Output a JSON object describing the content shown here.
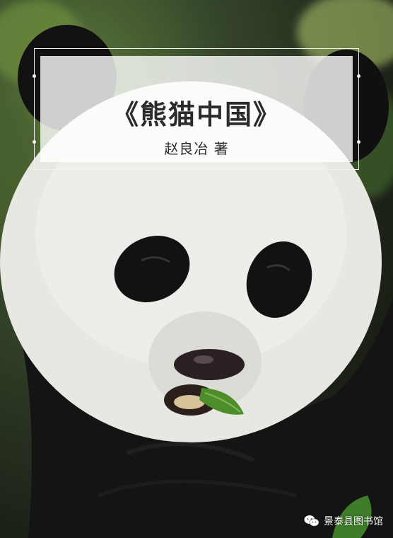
{
  "cover": {
    "title": "《熊猫中国》",
    "author": "赵良冶 著"
  },
  "watermark": {
    "icon": "wechat-icon",
    "text": "景泰县图书馆"
  },
  "colors": {
    "fur_white": "#e9e9e4",
    "fur_black": "#151515",
    "bamboo_green": "#4e8d2c",
    "panel": "#ffffff",
    "text": "#2b2b2b"
  }
}
